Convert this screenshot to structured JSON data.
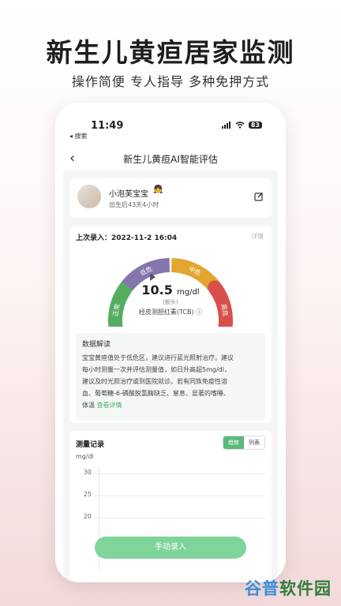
{
  "promo": {
    "title": "新生儿黄疸居家监测",
    "subtitle": "操作简便 专人指导 多种免押方式"
  },
  "status_bar": {
    "time": "11:49",
    "back_app": "◂ 搜索",
    "battery": "83"
  },
  "nav": {
    "back_icon": "chevron-left-icon",
    "title": "新生儿黄疸AI智能评估"
  },
  "profile": {
    "name": "小泡芙宝宝",
    "emoji": "👧",
    "age": "出生后43天4小时",
    "edit_icon": "edit-icon"
  },
  "reading": {
    "last_entry_label": "上次录入：2022-11-2 16:04",
    "detail_link": "详情",
    "value": "10.5",
    "unit": "mg/dl",
    "position": "(额头)",
    "method": "经皮测胆红素(TCB) ⓘ",
    "zones": [
      "正常",
      "低危",
      "中危",
      "高危"
    ],
    "zone_colors": [
      "#56ad62",
      "#8475ad",
      "#e2a62e",
      "#d8504c"
    ],
    "pointer_zone": "低危"
  },
  "analysis": {
    "title": "数据解读",
    "lines": [
      "宝宝黄疸值处于低危区，建议进行蓝光照射治疗。建议",
      "每小时测量一次并评估测量值，如日升高超5mg/dl，",
      "建议及时光照治疗或到医院就诊。若有同族免疫性溶",
      "血、葡萄糖-6-磷酸脱氢酶缺乏、窒息、显著的嗜睡、"
    ],
    "last_line": "体温",
    "more": "查看详情"
  },
  "records": {
    "title": "测量记录",
    "tab_trend": "趋势",
    "tab_list": "列表",
    "unit": "mg/dl",
    "yticks": [
      "30",
      "25",
      "20"
    ]
  },
  "actions": {
    "manual_entry": "手动录入"
  },
  "watermark": {
    "part1": "谷普",
    "part2": "软件园"
  }
}
